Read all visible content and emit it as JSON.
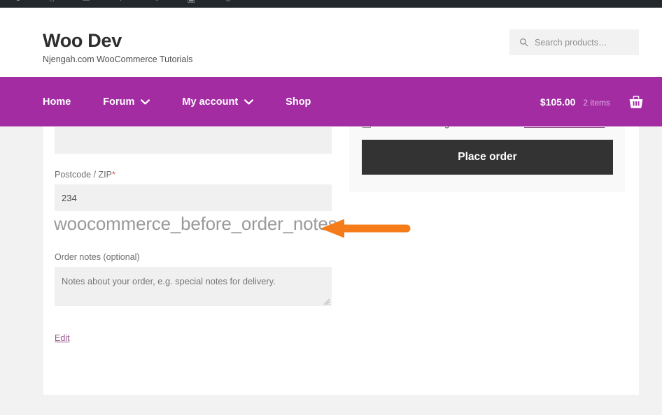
{
  "admin_bar": {
    "items": [
      "wp-logo-icon",
      "site-name",
      "comments-icon",
      "new-content",
      "edit-item",
      "woo-icon",
      "user-icon"
    ]
  },
  "header": {
    "site_title": "Woo Dev",
    "tagline": "Njengah.com WooCommerce Tutorials",
    "search": {
      "icon": "search-icon",
      "placeholder": "Search products…",
      "value": ""
    }
  },
  "nav": {
    "items": [
      {
        "label": "Home",
        "has_dropdown": false
      },
      {
        "label": "Forum",
        "has_dropdown": true,
        "caret": "chevron-down-icon"
      },
      {
        "label": "My account",
        "has_dropdown": true,
        "caret": "chevron-down-icon"
      },
      {
        "label": "Shop",
        "has_dropdown": false
      }
    ],
    "cart": {
      "total": "$105.00",
      "count": "2 items",
      "icon": "shopping-basket-icon"
    }
  },
  "checkout": {
    "fields": [
      {
        "label": "",
        "required": false,
        "value": "",
        "note": "field partially hidden behind sticky navigation"
      },
      {
        "label": "Postcode / ZIP",
        "required": true,
        "required_mark": "*",
        "value": "234"
      }
    ],
    "postcode": {
      "label": "Postcode / ZIP",
      "required_mark": "*",
      "value": "234"
    },
    "hook_heading": "woocommerce_before_order_notes",
    "order_notes": {
      "label": "Order notes (optional)",
      "placeholder": "Notes about your order, e.g. special notes for delivery.",
      "value": ""
    },
    "edit_link": "Edit"
  },
  "order_review": {
    "terms": {
      "text": "I have read and agree to the website",
      "link_text": "terms and conditions",
      "checked": false
    },
    "place_order_label": "Place order"
  },
  "annotation": {
    "arrow": "left-pointing-arrow",
    "color": "#f57c18"
  },
  "colors": {
    "nav_purple": "#a32ca3",
    "admin_bar": "#23282d",
    "button_dark": "#333333",
    "page_background": "#f2f2f2",
    "field_gray": "#f0f0f0",
    "link_purple": "#96568f",
    "accent_orange": "#f57c18",
    "required_red": "#d9534f"
  }
}
